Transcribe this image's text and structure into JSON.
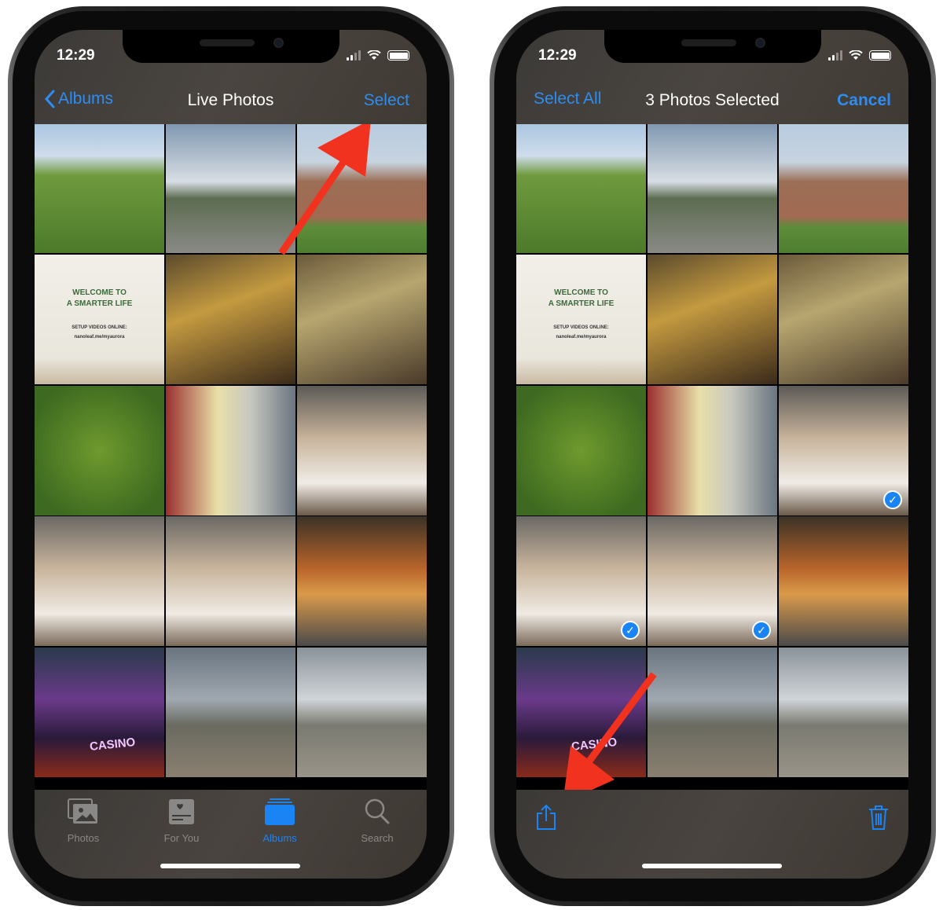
{
  "left_phone": {
    "status": {
      "time": "12:29"
    },
    "nav": {
      "back_label": "Albums",
      "title": "Live Photos",
      "action_label": "Select"
    },
    "tabs": [
      {
        "label": "Photos",
        "icon": "photos-icon",
        "active": false
      },
      {
        "label": "For You",
        "icon": "for-you-icon",
        "active": false
      },
      {
        "label": "Albums",
        "icon": "albums-icon",
        "active": true
      },
      {
        "label": "Search",
        "icon": "search-icon",
        "active": false
      }
    ]
  },
  "right_phone": {
    "status": {
      "time": "12:29"
    },
    "nav": {
      "select_all_label": "Select All",
      "title": "3 Photos Selected",
      "cancel_label": "Cancel"
    },
    "toolbar": {
      "share_icon": "share-icon",
      "delete_icon": "trash-icon"
    },
    "selected_tiles": [
      8,
      9,
      10
    ]
  },
  "photo_text": {
    "paper_line1": "WELCOME TO",
    "paper_line2": "A SMARTER LIFE",
    "paper_line3": "SETUP VIDEOS ONLINE:",
    "paper_line4": "nanoleaf.me/myaurora",
    "casino": "CASINO"
  },
  "colors": {
    "accent": "#1a84f5",
    "arrow": "#f0321e"
  }
}
